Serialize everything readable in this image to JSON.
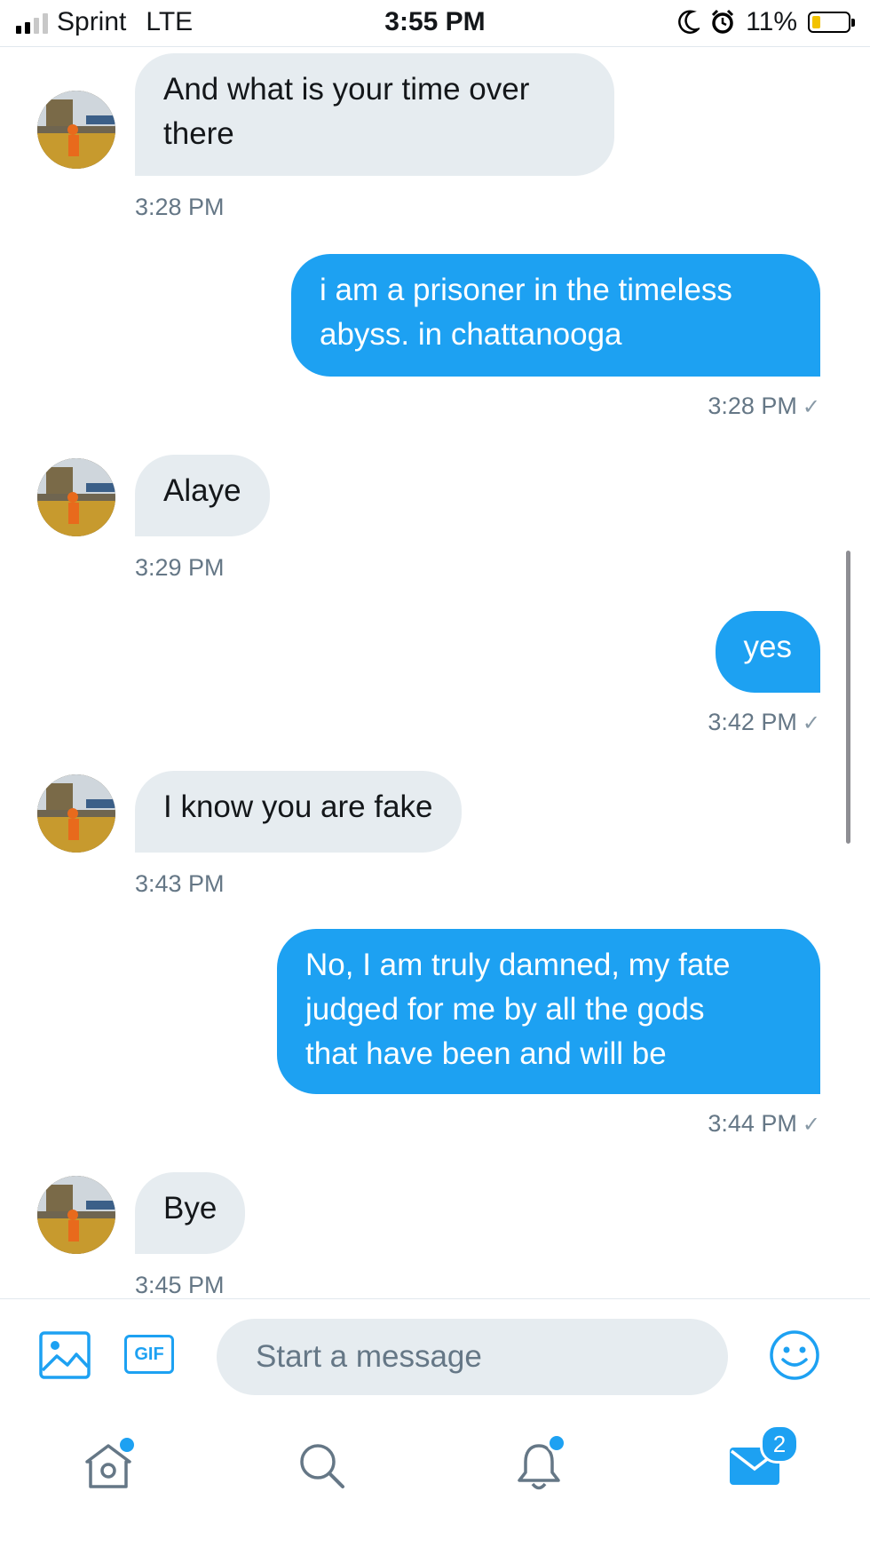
{
  "status_bar": {
    "carrier": "Sprint",
    "network": "LTE",
    "time": "3:55 PM",
    "battery_percent": "11%",
    "battery_level": 0.11,
    "battery_color": "#f2c200"
  },
  "messages": [
    {
      "direction": "in",
      "text": "And what is your time over there",
      "line1": "And what is your time over",
      "line2": "there",
      "time": "3:28 PM"
    },
    {
      "direction": "out",
      "line1": "i am a prisoner in the timeless",
      "line2": "abyss. in chattanooga",
      "time": "3:28 PM"
    },
    {
      "direction": "in",
      "text": "Alaye",
      "time": "3:29 PM"
    },
    {
      "direction": "out",
      "text": "yes",
      "time": "3:42 PM"
    },
    {
      "direction": "in",
      "text": "I know you are fake",
      "time": "3:43 PM"
    },
    {
      "direction": "out",
      "line1": "No, I am truly damned, my fate",
      "line2": "judged for me by all the gods",
      "line3": "that have been and will be",
      "time": "3:44 PM"
    },
    {
      "direction": "in",
      "text": "Bye",
      "time": "3:45 PM"
    }
  ],
  "read_check": "✓",
  "composer": {
    "placeholder": "Start a message",
    "gif_label": "GIF"
  },
  "tab_bar": {
    "messages_badge": "2"
  },
  "colors": {
    "accent": "#1da1f2",
    "incoming_bubble": "#e6ecf0",
    "timestamp": "#657786"
  }
}
